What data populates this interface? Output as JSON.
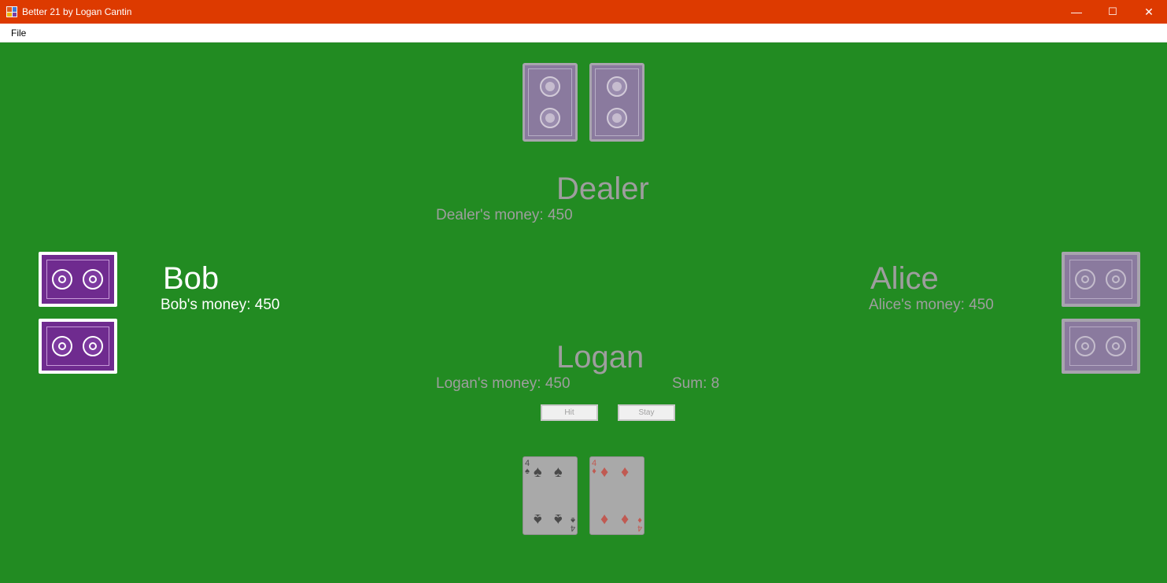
{
  "window": {
    "title": "Better 21 by Logan Cantin",
    "icon": "app-icon",
    "controls": {
      "minimize": "—",
      "maximize": "☐",
      "close": "✕"
    }
  },
  "menu": {
    "file": "File"
  },
  "colors": {
    "titlebar": "#DD3A00",
    "table": "#228B22",
    "card_back_active": "#6F2B8F",
    "card_back_dim": "#8A7A9E",
    "inactive_text": "#9E9E9E",
    "active_text": "#FFFFFF"
  },
  "dealer": {
    "name": "Dealer",
    "money_label": "Dealer's money: 450",
    "cards": [
      "face-down",
      "face-down"
    ]
  },
  "bob": {
    "name": "Bob",
    "money_label": "Bob's money: 450",
    "active": true,
    "cards": [
      "face-down",
      "face-down"
    ]
  },
  "alice": {
    "name": "Alice",
    "money_label": "Alice's money: 450",
    "active": false,
    "cards": [
      "face-down",
      "face-down"
    ]
  },
  "logan": {
    "name": "Logan",
    "money_label": "Logan's money: 450",
    "sum_label": "Sum: 8",
    "buttons": {
      "hit": "Hit",
      "stay": "Stay"
    },
    "cards": [
      {
        "rank": "4",
        "suit": "spades",
        "symbol": "♠"
      },
      {
        "rank": "4",
        "suit": "diamonds",
        "symbol": "♦"
      }
    ]
  }
}
